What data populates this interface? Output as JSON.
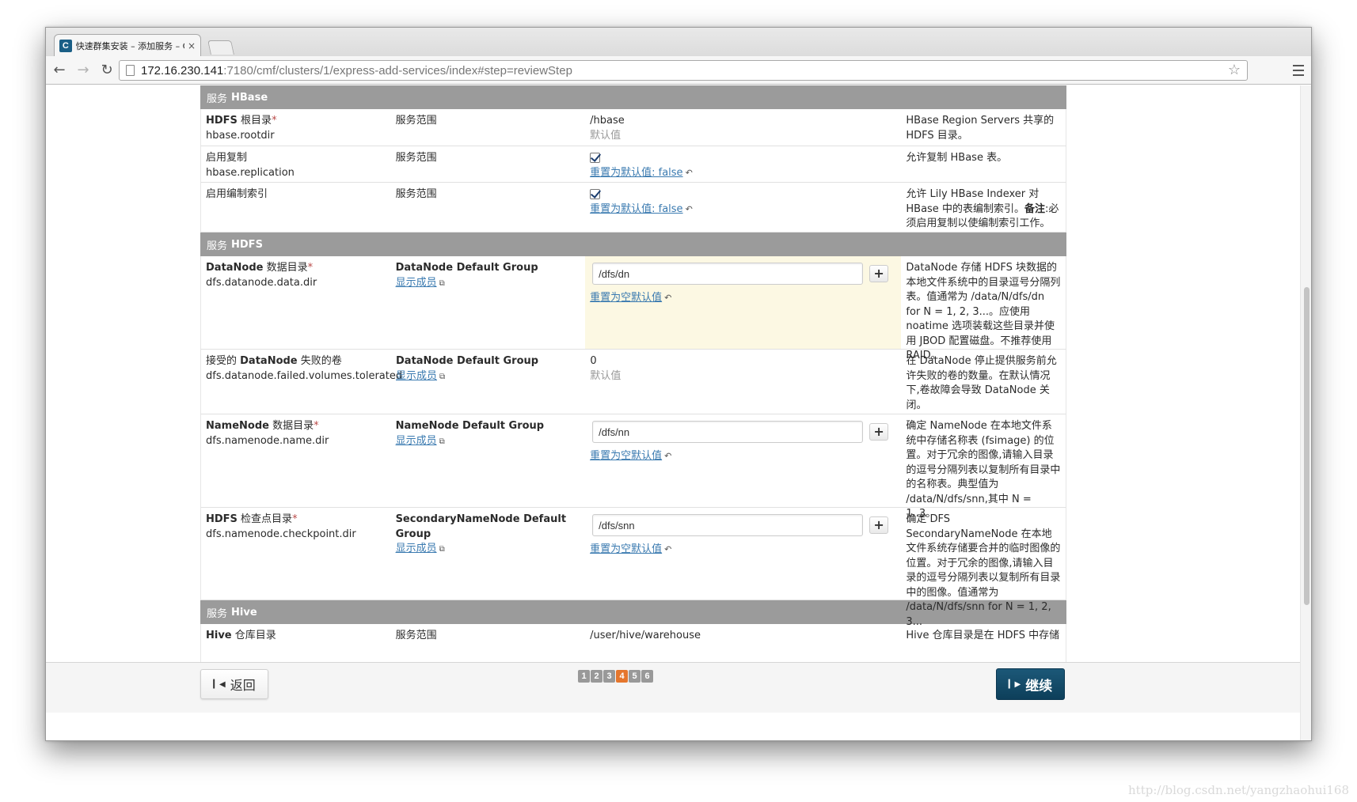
{
  "browser": {
    "tab_title": "快速群集安装 – 添加服务 – C",
    "tab_close": "×",
    "favicon_letter": "C",
    "url_host": "172.16.230.141",
    "url_rest": ":7180/cmf/clusters/1/express-add-services/index#step=reviewStep"
  },
  "sections": {
    "hbase": {
      "label": "服务",
      "name": "HBase",
      "rows": [
        {
          "label_bold": "HDFS",
          "label_rest": " 根目录",
          "required": "*",
          "key": "hbase.rootdir",
          "scope": "服务范围",
          "value": "/hbase",
          "value_note": "默认值",
          "desc": "HBase Region Servers 共享的 HDFS 目录。"
        },
        {
          "label_rest": "启用复制",
          "key": "hbase.replication",
          "scope": "服务范围",
          "reset": "重置为默认值: false",
          "desc": "允许复制 HBase 表。"
        },
        {
          "label_rest": "启用编制索引",
          "scope": "服务范围",
          "reset": "重置为默认值: false",
          "desc_a": "允许 Lily HBase Indexer 对 HBase 中的表编制索引。",
          "desc_bold": "备注",
          "desc_b": ":必须启用复制以使编制索引工作。"
        }
      ]
    },
    "hdfs": {
      "label": "服务",
      "name": "HDFS",
      "rows": [
        {
          "label_bold": "DataNode",
          "label_rest": " 数据目录",
          "required": "*",
          "key": "dfs.datanode.data.dir",
          "scope_title": "DataNode Default Group",
          "members": "显示成员",
          "value": "/dfs/dn",
          "reset": "重置为空默认值",
          "desc": "DataNode 存储 HDFS 块数据的本地文件系统中的目录逗号分隔列表。值通常为 /data/N/dfs/dn for N = 1, 2, 3...。应使用 noatime 选项装载这些目录并使用 JBOD 配置磁盘。不推荐使用 RAID。"
        },
        {
          "label_rest_a": "接受的 ",
          "label_bold": "DataNode",
          "label_rest": " 失败的卷",
          "key": "dfs.datanode.failed.volumes.tolerated",
          "scope_title": "DataNode Default Group",
          "members": "显示成员",
          "value": "0",
          "value_note": "默认值",
          "desc": "在 DataNode 停止提供服务前允许失败的卷的数量。在默认情况下,卷故障会导致 DataNode 关闭。"
        },
        {
          "label_bold": "NameNode",
          "label_rest": " 数据目录",
          "required": "*",
          "key": "dfs.namenode.name.dir",
          "scope_title": "NameNode Default Group",
          "members": "显示成员",
          "value": "/dfs/nn",
          "reset": "重置为空默认值",
          "desc": "确定 NameNode 在本地文件系统中存储名称表 (fsimage) 的位置。对于冗余的图像,请输入目录的逗号分隔列表以复制所有目录中的名称表。典型值为 /data/N/dfs/snn,其中 N = 1..3。"
        },
        {
          "label_bold": "HDFS",
          "label_rest": " 检查点目录",
          "required": "*",
          "key": "dfs.namenode.checkpoint.dir",
          "scope_title": "SecondaryNameNode Default Group",
          "members": "显示成员",
          "value": "/dfs/snn",
          "reset": "重置为空默认值",
          "desc": "确定 DFS SecondaryNameNode 在本地文件系统存储要合并的临时图像的位置。对于冗余的图像,请输入目录的逗号分隔列表以复制所有目录中的图像。值通常为 /data/N/dfs/snn for N = 1, 2, 3..."
        }
      ]
    },
    "hive": {
      "label": "服务",
      "name": "Hive",
      "rows": [
        {
          "label_bold": "Hive",
          "label_rest": " 仓库目录",
          "scope": "服务范围",
          "value": "/user/hive/warehouse",
          "desc": "Hive 仓库目录是在 HDFS 中存储"
        }
      ]
    }
  },
  "footer": {
    "back_label": "返回",
    "next_label": "继续",
    "pages": [
      "1",
      "2",
      "3",
      "4",
      "5",
      "6"
    ],
    "current_page": "4"
  },
  "watermark": "http://blog.csdn.net/yangzhaohui168",
  "colors": {
    "section_header": "#9b9b9b",
    "link": "#3a7ab0",
    "primary_button": "#0d3f5a",
    "active_page": "#e5762d",
    "highlight_row": "#fcf8e3"
  }
}
